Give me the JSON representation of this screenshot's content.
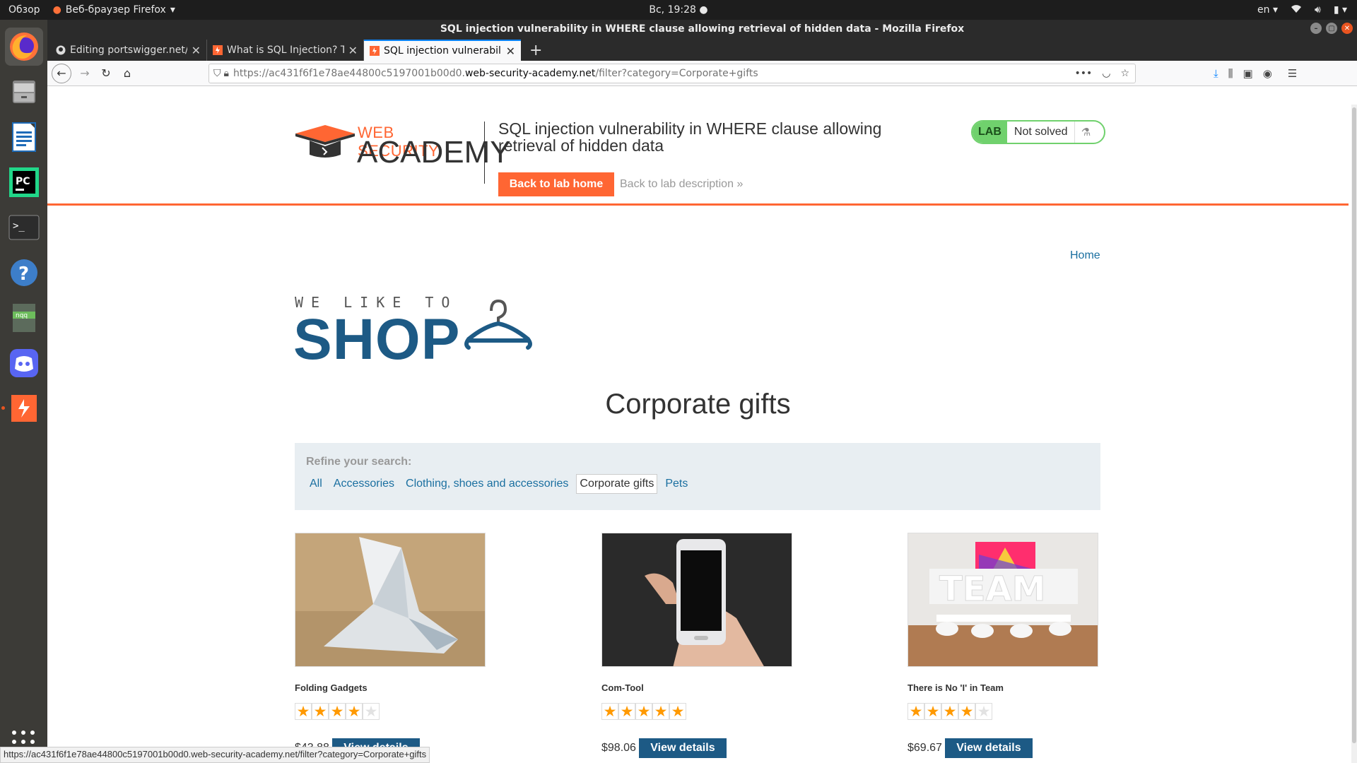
{
  "desktop": {
    "activities": "Обзор",
    "app_menu": "Веб-браузер Firefox",
    "clock": "Вс, 19:28",
    "lang": "en"
  },
  "window": {
    "title": "SQL injection vulnerability in WHERE clause allowing retrieval of hidden data - Mozilla Firefox"
  },
  "tabs": [
    {
      "label": "Editing portswigger.net/",
      "icon": "github-icon",
      "active": false
    },
    {
      "label": "What is SQL Injection? Tu",
      "icon": "portswigger-icon",
      "active": false
    },
    {
      "label": "SQL injection vulnerabili",
      "icon": "portswigger-icon",
      "active": true
    }
  ],
  "url": {
    "prefix": "https://ac431f6f1e78ae44800c5197001b00d0.",
    "domain": "web-security-academy.net",
    "path": "/filter?category=Corporate+gifts"
  },
  "academy": {
    "logo_top": "WEB SECURITY",
    "logo_bottom": "ACADEMY",
    "lab_title": "SQL injection vulnerability in WHERE clause allowing retrieval of hidden data",
    "back_home": "Back to lab home",
    "back_desc": "Back to lab description",
    "lab_badge": "LAB",
    "lab_status": "Not solved"
  },
  "shop": {
    "home": "Home",
    "logo_line1": "WE LIKE TO",
    "logo_line2": "SHOP",
    "category_title": "Corporate gifts",
    "refine_label": "Refine your search:",
    "filters": [
      "All",
      "Accessories",
      "Clothing, shoes and accessories",
      "Corporate gifts",
      "Pets"
    ],
    "selected_filter": "Corporate gifts"
  },
  "products": [
    {
      "name": "Folding Gadgets",
      "rating": 4,
      "price": "$43.88",
      "button": "View details"
    },
    {
      "name": "Com-Tool",
      "rating": 5,
      "price": "$98.06",
      "button": "View details"
    },
    {
      "name": "There is No 'I' in Team",
      "rating": 4,
      "price": "$69.67",
      "button": "View details"
    }
  ],
  "status_url": "https://ac431f6f1e78ae44800c5197001b00d0.web-security-academy.net/filter?category=Corporate+gifts",
  "colors": {
    "accent": "#ff6633",
    "shop_blue": "#1d5a85",
    "link": "#1a6fa0",
    "lab_green": "#70d16d"
  }
}
